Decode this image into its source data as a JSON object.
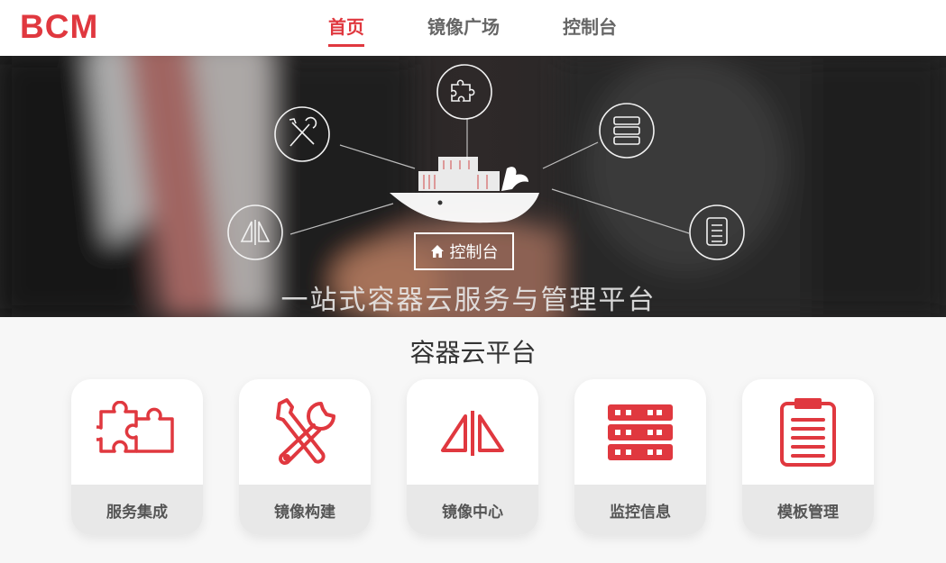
{
  "header": {
    "logo": "BCM",
    "nav": [
      {
        "label": "首页",
        "active": true
      },
      {
        "label": "镜像广场",
        "active": false
      },
      {
        "label": "控制台",
        "active": false
      }
    ]
  },
  "hero": {
    "console_button": "控制台",
    "slogan": "一站式容器云服务与管理平台"
  },
  "section": {
    "title": "容器云平台"
  },
  "cards": [
    {
      "label": "服务集成",
      "icon": "puzzle-icon"
    },
    {
      "label": "镜像构建",
      "icon": "tools-icon"
    },
    {
      "label": "镜像中心",
      "icon": "mirror-icon"
    },
    {
      "label": "监控信息",
      "icon": "server-icon"
    },
    {
      "label": "模板管理",
      "icon": "clipboard-icon"
    }
  ],
  "colors": {
    "accent": "#e0383f",
    "nav_text": "#666666",
    "card_label_bg": "#e8e8e8"
  }
}
